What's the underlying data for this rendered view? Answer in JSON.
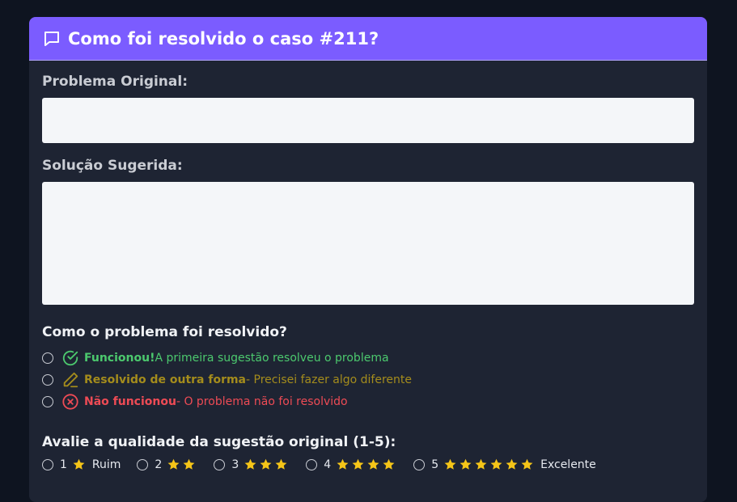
{
  "header": {
    "title": "Como foi resolvido o caso #211?",
    "icon": "chat-bubble-icon"
  },
  "fields": {
    "problem_label": "Problema Original:",
    "problem_value": "",
    "solution_label": "Solução Sugerida:",
    "solution_value": ""
  },
  "resolution": {
    "title": "Como o problema foi resolvido?",
    "options": [
      {
        "strong": "Funcionou!",
        "rest": " A primeira sugestão resolveu o problema",
        "icon": "check-circle-icon",
        "color": "#4cc96e"
      },
      {
        "strong": "Resolvido de outra forma",
        "rest": " - Precisei fazer algo diferente",
        "icon": "pencil-icon",
        "color": "#a48c1c"
      },
      {
        "strong": "Não funcionou",
        "rest": " - O problema não foi resolvido",
        "icon": "x-circle-icon",
        "color": "#ee4b55"
      }
    ]
  },
  "rating": {
    "title": "Avalie a qualidade da sugestão original (1-5):",
    "options": [
      {
        "num": "1",
        "stars": 1,
        "word": "Ruim"
      },
      {
        "num": "2",
        "stars": 2,
        "word": ""
      },
      {
        "num": "3",
        "stars": 3,
        "word": ""
      },
      {
        "num": "4",
        "stars": 4,
        "word": ""
      },
      {
        "num": "5",
        "stars": 5,
        "word": "Excelente"
      }
    ],
    "star_color": "#f5c518"
  },
  "colors": {
    "header": "#7b5cff",
    "card": "#1e2433",
    "page": "#0e1420"
  }
}
